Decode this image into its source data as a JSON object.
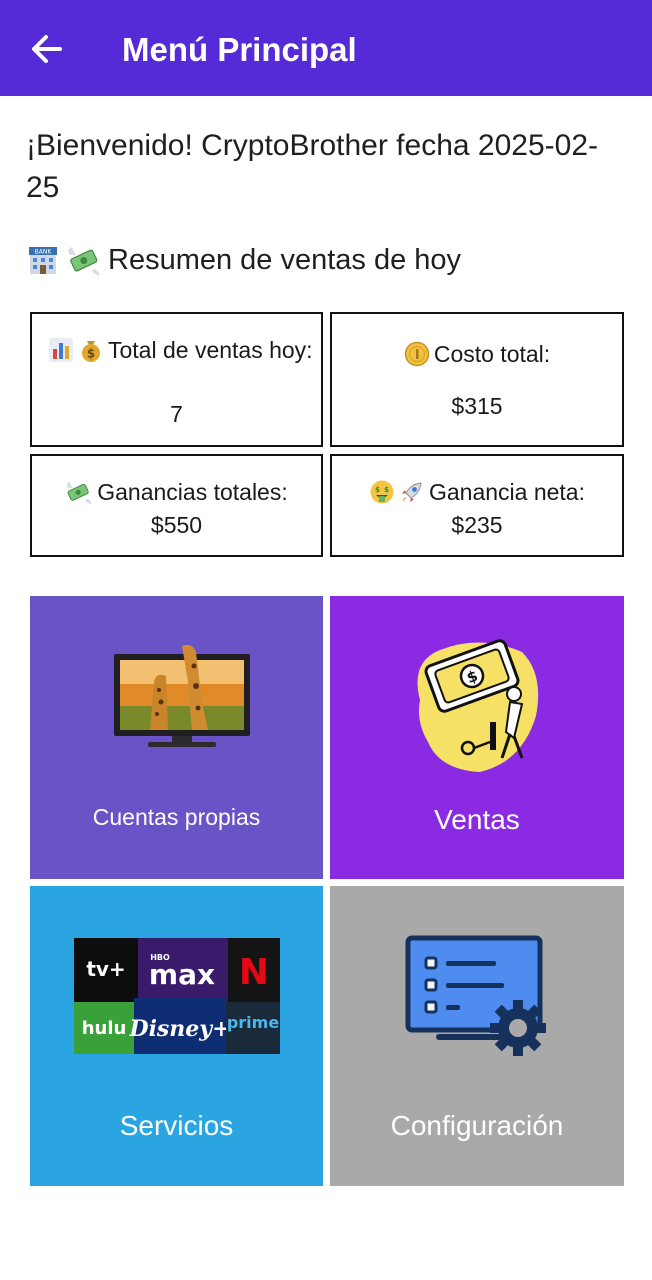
{
  "colors": {
    "appbar": "#552bd8",
    "tile_cuentas": "#6953c7",
    "tile_ventas": "#8a2be3",
    "tile_servicios": "#2aa5e2",
    "tile_config": "#a9a9a9"
  },
  "appbar": {
    "title": "Menú Principal",
    "back_icon": "arrow-left-icon"
  },
  "welcome": {
    "text": "¡Bienvenido! CryptoBrother fecha 2025-02-25"
  },
  "summary": {
    "heading": "Resumen de ventas de hoy",
    "icons": [
      "bank-icon",
      "money-with-wings-icon"
    ],
    "cards": [
      {
        "label": "Total de ventas hoy:",
        "value": "7",
        "icons": [
          "bar-chart-icon",
          "money-bag-icon"
        ]
      },
      {
        "label": "Costo total:",
        "value": "$315",
        "icons": [
          "coin-icon"
        ]
      },
      {
        "label": "Ganancias totales:",
        "value": "$550",
        "icons": [
          "money-with-wings-icon"
        ]
      },
      {
        "label": "Ganancia neta:",
        "value": "$235",
        "icons": [
          "money-mouth-face-icon",
          "rocket-icon"
        ]
      }
    ]
  },
  "menu": {
    "tiles": [
      {
        "label": "Cuentas propias",
        "image": "tv-image"
      },
      {
        "label": "Ventas",
        "image": "money-press-image"
      },
      {
        "label": "Servicios",
        "image": "streaming-logos-image"
      },
      {
        "label": "Configuración",
        "image": "settings-screen-image"
      }
    ],
    "streaming_logos": [
      "tv+",
      "max",
      "N",
      "hulu",
      "Disney+",
      "prime"
    ]
  }
}
